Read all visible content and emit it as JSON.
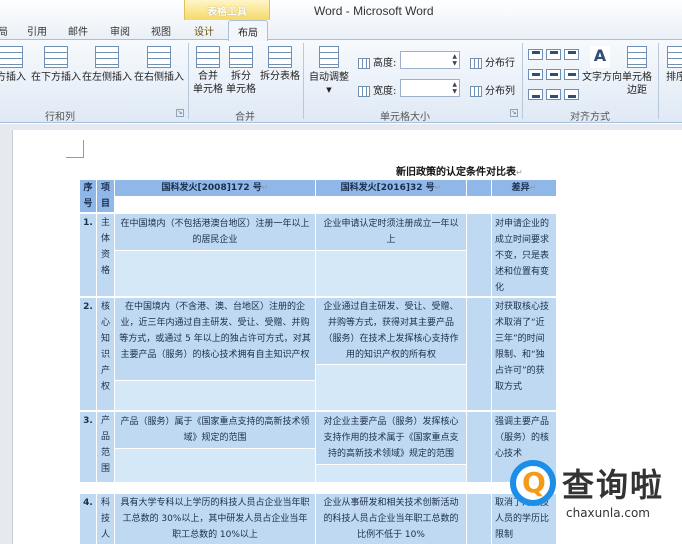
{
  "window": {
    "title": "Word - Microsoft Word",
    "context_group": "表格工具"
  },
  "tabs": [
    "局",
    "引用",
    "邮件",
    "审阅",
    "视图",
    "设计",
    "布局"
  ],
  "active_tab": "布局",
  "ribbon": {
    "rows_cols": {
      "buttons": [
        "方插入",
        "在下方插入",
        "在左侧插入",
        "在右侧插入"
      ],
      "label": "行和列"
    },
    "merge": {
      "buttons": [
        {
          "line1": "合并",
          "line2": "单元格"
        },
        {
          "line1": "拆分",
          "line2": "单元格"
        },
        {
          "line1": "拆分表格",
          "line2": ""
        }
      ],
      "label": "合并"
    },
    "cell_size": {
      "autofit": "自动调整",
      "height_label": "高度:",
      "width_label": "宽度:",
      "distribute_rows": "分布行",
      "distribute_cols": "分布列",
      "label": "单元格大小"
    },
    "alignment": {
      "text_direction": "文字方向",
      "cell_margins_line1": "单元格",
      "cell_margins_line2": "边距",
      "sort": "排序",
      "label": "对齐方式"
    }
  },
  "document": {
    "title": "新旧政策的认定条件对比表",
    "table": {
      "headers": [
        "序号",
        "项目",
        "国科发火[2008]172 号",
        "国科发火[2016]32 号",
        "差异"
      ],
      "rows": [
        {
          "no": "1.",
          "item": "主体资格",
          "old": "在中国境内（不包括港澳台地区）注册一年以上的居民企业",
          "new": "企业申请认定时须注册成立一年以上",
          "diff": "对申请企业的成立时间要求不变，只是表述和位置有变化"
        },
        {
          "no": "2.",
          "item": "核心知识产权",
          "old": "在中国境内（不含港、澳、台地区）注册的企业，近三年内通过自主研发、受让、受赠、并购等方式，或通过 5 年以上的独占许可方式，对其主要产品（服务）的核心技术拥有自主知识产权",
          "new": "企业通过自主研发、受让、受赠、并购等方式，获得对其主要产品（服务）在技术上发挥核心支持作用的知识产权的所有权",
          "diff": "对获取核心技术取消了“近三年”的时间限制、和“独占许可”的获取方式"
        },
        {
          "no": "3.",
          "item": "产品范围",
          "old": "产品（服务）属于《国家重点支持的高新技术领域》规定的范围",
          "new": "对企业主要产品（服务）发挥核心支持作用的技术属于《国家重点支持的高新技术领域》规定的范围",
          "diff": "强调主要产品（服务）的核心技术"
        },
        {
          "no": "4.",
          "item": "科技人员",
          "old": "具有大学专科以上学历的科技人员占企业当年职工总数的 30%以上，其中研发人员占企业当年职工总数的 10%以上",
          "new": "企业从事研发和相关技术创新活动的科技人员占企业当年职工总数的比例不低于 10%",
          "diff": "取消了对科技人员的学历比限制"
        }
      ]
    }
  },
  "watermark": {
    "brand": "查询啦",
    "url": "chaxunla.com"
  },
  "colors": {
    "header_cell": "#8fb8e8",
    "body_cell": "#bfd9f2",
    "ribbon_bg": "#dfe9f5",
    "context_tab": "#f5d96a",
    "watermark_blue": "#1c8ee8",
    "watermark_orange": "#f39a1a"
  }
}
